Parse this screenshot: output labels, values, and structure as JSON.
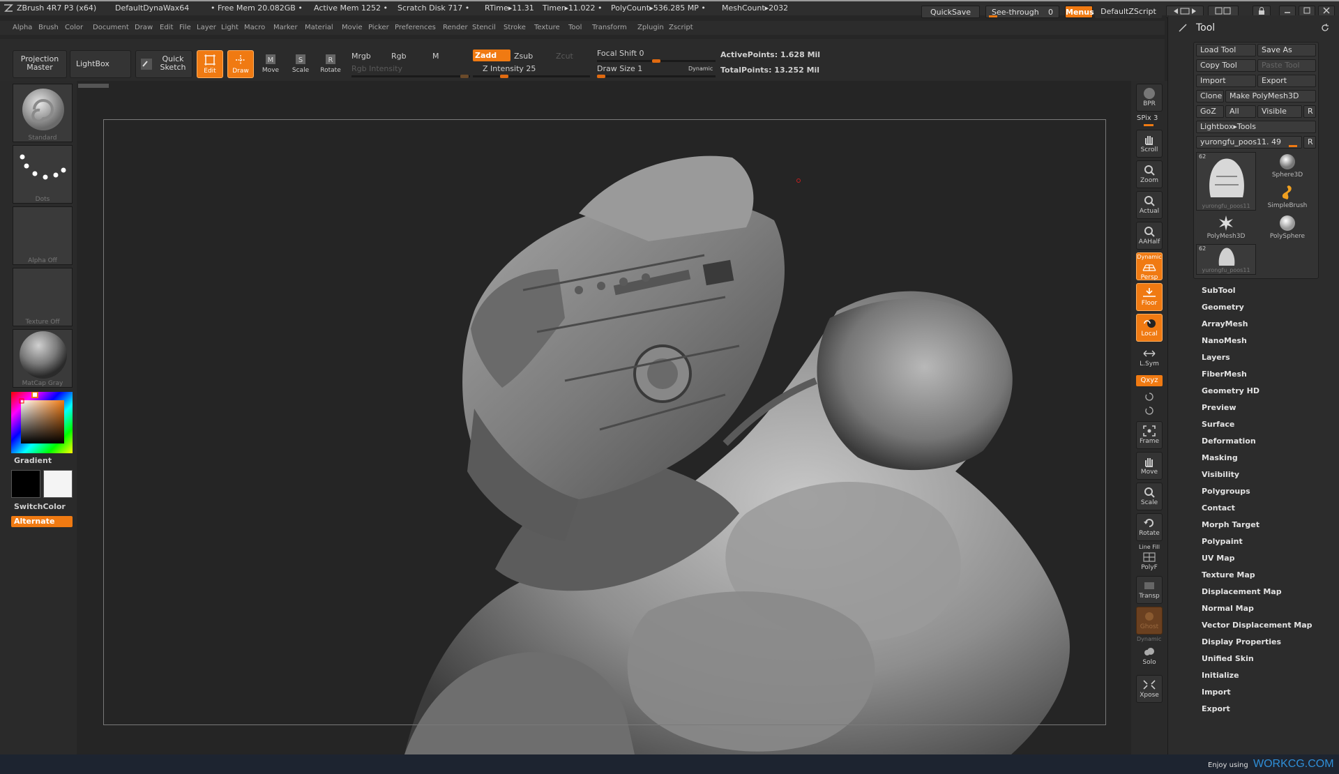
{
  "titlebar": {
    "app": "ZBrush 4R7 P3 (x64)",
    "document": "DefaultDynaWax64",
    "free_mem": "• Free Mem 20.082GB •",
    "active_mem": "Active Mem 1252 •",
    "scratch": "Scratch Disk 717 •",
    "rtime": "RTime▸11.31",
    "timer": "Timer▸11.022 •",
    "polycount": "PolyCount▸536.285 MP •",
    "meshcount": "MeshCount▸2032",
    "quicksave": "QuickSave",
    "seethrough": "See-through",
    "seethrough_value": "0",
    "menus": "Menus",
    "zscript": "DefaultZScript"
  },
  "menubar": [
    "Alpha",
    "Brush",
    "Color",
    "Document",
    "Draw",
    "Edit",
    "File",
    "Layer",
    "Light",
    "Macro",
    "Marker",
    "Material",
    "Movie",
    "Picker",
    "Preferences",
    "Render",
    "Stencil",
    "Stroke",
    "Texture",
    "Tool",
    "Transform",
    "Zplugin",
    "Zscript"
  ],
  "toolbar": {
    "projection_master": "Projection Master",
    "lightbox": "LightBox",
    "quick_sketch": "Quick Sketch",
    "edit": "Edit",
    "draw": "Draw",
    "move": "Move",
    "scale": "Scale",
    "rotate": "Rotate",
    "mrgb": "Mrgb",
    "rgb": "Rgb",
    "m": "M",
    "rgb_intensity": "Rgb Intensity",
    "zadd": "Zadd",
    "zsub": "Zsub",
    "zcut": "Zcut",
    "z_intensity": "Z Intensity 25",
    "z_intensity_level": 0.25,
    "focal_shift": "Focal Shift 0",
    "draw_size": "Draw Size 1",
    "dynamic": "Dynamic",
    "active_points": "ActivePoints: 1.628  Mil",
    "total_points": "TotalPoints: 13.252  Mil"
  },
  "leftshelf": {
    "brush": "Standard",
    "stroke": "Dots",
    "alpha": "Alpha  Off",
    "texture": "Texture  Off",
    "material": "MatCap  Gray",
    "gradient": "Gradient",
    "switchcolor": "SwitchColor",
    "alternate": "Alternate"
  },
  "rightshelf": {
    "bpr": "BPR",
    "spix": "SPix 3",
    "scroll": "Scroll",
    "zoom": "Zoom",
    "actual": "Actual",
    "aahalf": "AAHalf",
    "dynamic": "Dynamic",
    "persp": "Persp",
    "floor": "Floor",
    "local": "Local",
    "lsym": "L.Sym",
    "xyz": "Qxyz",
    "frame": "Frame",
    "move": "Move",
    "scale": "Scale",
    "rotate": "Rotate",
    "linefill": "Line Fill",
    "polyf": "PolyF",
    "transp": "Transp",
    "ghost": "Ghost",
    "dynamic2": "Dynamic",
    "solo": "Solo",
    "xpose": "Xpose"
  },
  "toolpanel": {
    "title": "Tool",
    "load_tool": "Load Tool",
    "save_as": "Save As",
    "copy_tool": "Copy Tool",
    "paste_tool": "Paste Tool",
    "import": "Import",
    "export": "Export",
    "clone": "Clone",
    "make_polymesh": "Make PolyMesh3D",
    "goz": "GoZ",
    "all": "All",
    "visible": "Visible",
    "r": "R",
    "lightbox_tools": "Lightbox▸Tools",
    "current_tool": "yurongfu_poos11. 49",
    "thumbs": [
      {
        "name": "yurongfu_poos11",
        "count": "62"
      },
      {
        "name": "Sphere3D",
        "count": ""
      },
      {
        "name": "SimpleBrush",
        "count": ""
      },
      {
        "name": "PolyMesh3D",
        "count": ""
      },
      {
        "name": "PolySphere",
        "count": ""
      },
      {
        "name": "yurongfu_poos11",
        "count": "62"
      }
    ],
    "subpalettes": [
      "SubTool",
      "Geometry",
      "ArrayMesh",
      "NanoMesh",
      "Layers",
      "FiberMesh",
      "Geometry HD",
      "Preview",
      "Surface",
      "Deformation",
      "Masking",
      "Visibility",
      "Polygroups",
      "Contact",
      "Morph Target",
      "Polypaint",
      "UV Map",
      "Texture Map",
      "Displacement Map",
      "Normal Map",
      "Vector Displacement Map",
      "Display Properties",
      "Unified Skin",
      "Initialize",
      "Import",
      "Export"
    ]
  },
  "bottombar": {
    "enjoy": "Enjoy using",
    "brand": "WORKCG.COM"
  },
  "colors": {
    "accent": "#f07a12",
    "background": "#262626",
    "panel": "#2c2c2c",
    "brand": "#2f8fd8"
  }
}
